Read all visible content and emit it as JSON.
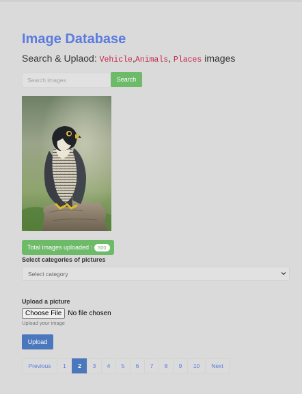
{
  "header": {
    "title": "Image Database",
    "subtitle_prefix": "Search & Uplaod:",
    "category_vehicle": "Vehicle",
    "sep1": ",",
    "category_animals": "Animals",
    "sep2": ",",
    "category_places": "Places",
    "subtitle_suffix": "images"
  },
  "search": {
    "placeholder": "Search images",
    "button_label": "Search"
  },
  "gallery": {
    "image_subject": "peregrine falcon perched on a tree stump"
  },
  "stats": {
    "total_label": "Total images uploaded :",
    "total_count": "500"
  },
  "categories": {
    "label": "Select categories of pictures",
    "selected": "Select category"
  },
  "upload": {
    "label": "Upload a picture",
    "choose_file_label": "Choose File",
    "file_status": "No file chosen",
    "help_text": "Upload your image",
    "button_label": "Upload"
  },
  "pagination": {
    "previous": "Previous",
    "pages": [
      "1",
      "2",
      "3",
      "4",
      "5",
      "6",
      "7",
      "8",
      "9",
      "10"
    ],
    "active_page": "2",
    "next": "Next"
  },
  "colors": {
    "accent_blue": "#5b7bde",
    "primary_button": "#4b77bd",
    "success_green": "#6dba69",
    "code_red": "#c7254e",
    "background": "#dadada"
  },
  "icons": {
    "select_arrow": "chevron-down-icon"
  }
}
